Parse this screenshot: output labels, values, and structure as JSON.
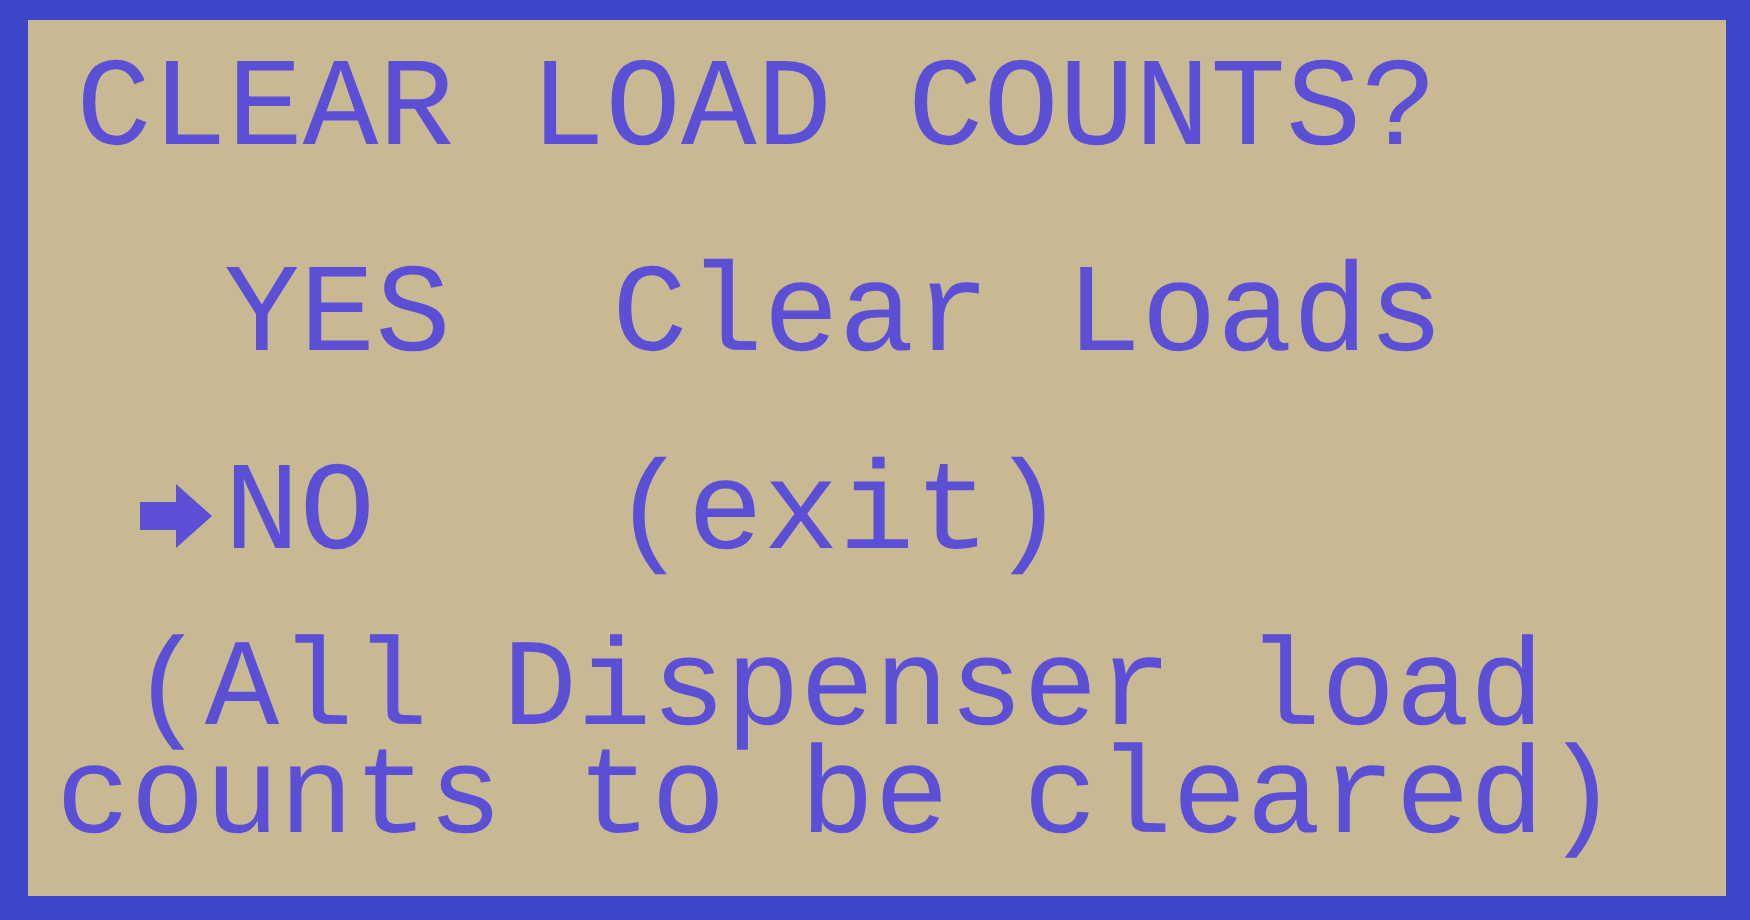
{
  "title": "CLEAR LOAD COUNTS?",
  "options": [
    {
      "label": "YES",
      "description": "Clear Loads",
      "selected": false
    },
    {
      "label": "NO",
      "description": "(exit)",
      "selected": true
    }
  ],
  "note_lines": [
    " (All Dispenser load",
    "counts to be cleared)"
  ]
}
